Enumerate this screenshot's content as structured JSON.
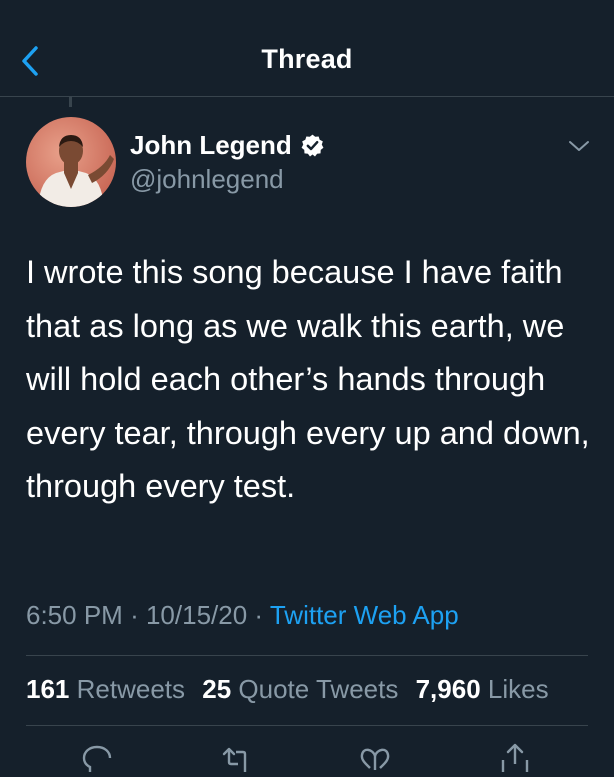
{
  "header": {
    "title": "Thread",
    "back_icon": "chevron-left-icon"
  },
  "tweet": {
    "display_name": "John Legend",
    "handle": "@johnlegend",
    "verified_icon": "verified-badge-icon",
    "text": "I wrote this song because I have faith that as long as we walk this earth, we will hold each other’s hands through every tear, through every up and down, through every test.",
    "time": "6:50 PM",
    "separator": "·",
    "date": "10/15/20",
    "source": "Twitter Web App",
    "stats": {
      "retweets_count": "161",
      "retweets_label": "Retweets",
      "quotes_count": "25",
      "quotes_label": "Quote Tweets",
      "likes_count": "7,960",
      "likes_label": "Likes"
    }
  },
  "actions": [
    "reply-icon",
    "retweet-icon",
    "like-icon",
    "share-icon"
  ],
  "colors": {
    "background": "#15202b",
    "accent": "#1da1f2",
    "secondary_text": "#8899a6",
    "divider": "#38444d"
  }
}
